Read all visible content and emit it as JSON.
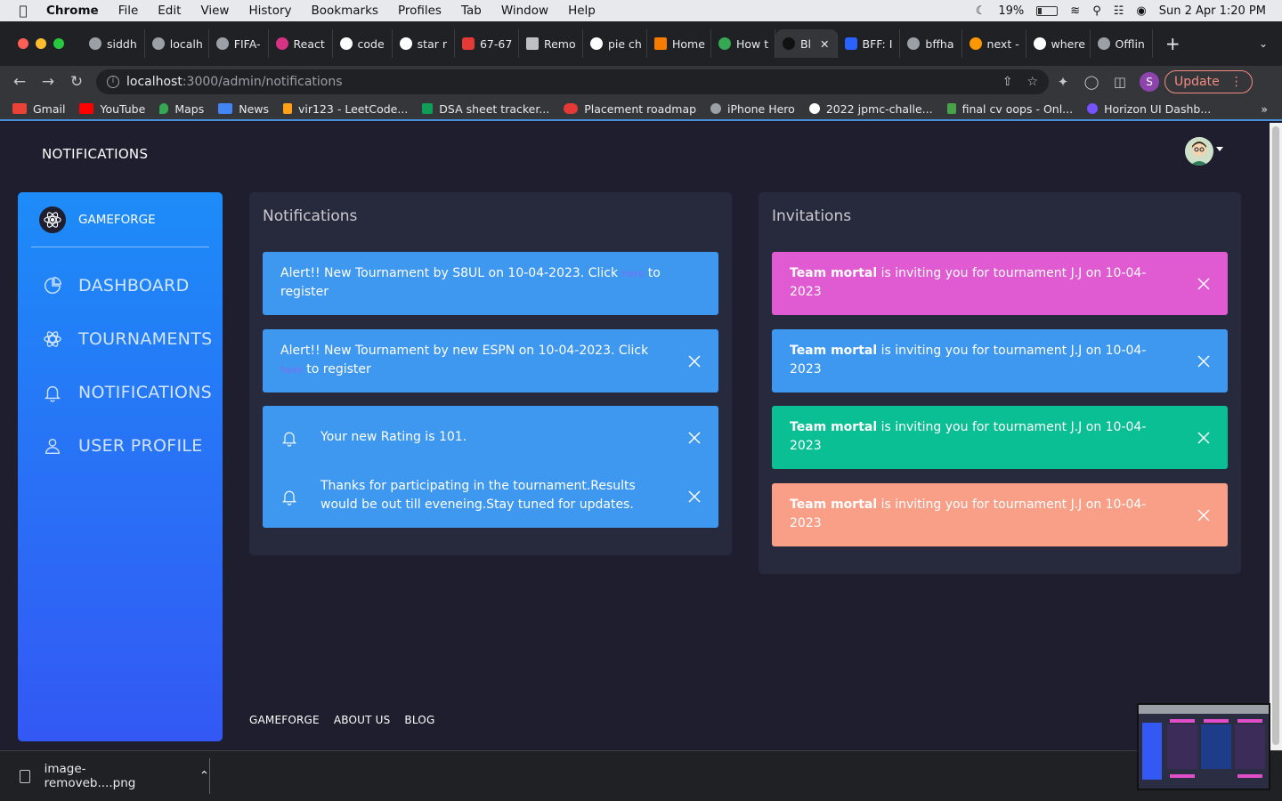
{
  "menubar": {
    "app": "Chrome",
    "items": [
      "File",
      "Edit",
      "View",
      "History",
      "Bookmarks",
      "Profiles",
      "Tab",
      "Window",
      "Help"
    ],
    "battery": "19%",
    "datetime": "Sun 2 Apr  1:20 PM"
  },
  "tabs": [
    {
      "label": "siddh",
      "icon": "github-icon"
    },
    {
      "label": "localh",
      "icon": "globe-icon"
    },
    {
      "label": "FIFA-",
      "icon": "globe-icon"
    },
    {
      "label": "React",
      "icon": "react-icon"
    },
    {
      "label": "code",
      "icon": "google-icon"
    },
    {
      "label": "star r",
      "icon": "google-icon"
    },
    {
      "label": "67-67",
      "icon": "c-icon"
    },
    {
      "label": "Remo",
      "icon": "layers-icon"
    },
    {
      "label": "pie ch",
      "icon": "google-icon"
    },
    {
      "label": "Home",
      "icon": "grid-icon"
    },
    {
      "label": "How t",
      "icon": "link-icon"
    },
    {
      "label": "Bl",
      "icon": "mask-icon",
      "active": true
    },
    {
      "label": "BFF: I",
      "icon": "doc-icon"
    },
    {
      "label": "bffha",
      "icon": "globe-icon"
    },
    {
      "label": "next -",
      "icon": "fire-icon"
    },
    {
      "label": "where",
      "icon": "google-icon"
    },
    {
      "label": "Offlin",
      "icon": "globe-icon"
    }
  ],
  "address": {
    "host": "localhost",
    "path": ":3000/admin/notifications",
    "update_label": "Update",
    "profile_initial": "S"
  },
  "bookmarks": [
    {
      "label": "Gmail",
      "color": "#ea4335"
    },
    {
      "label": "YouTube",
      "color": "#ff0000"
    },
    {
      "label": "Maps",
      "color": "#34a853"
    },
    {
      "label": "News",
      "color": "#4285f4"
    },
    {
      "label": "vir123 - LeetCode...",
      "color": "#ffa116"
    },
    {
      "label": "DSA sheet tracker...",
      "color": "#0f9d58"
    },
    {
      "label": "Placement roadmap",
      "color": "#e53935"
    },
    {
      "label": "iPhone Hero",
      "color": "#9aa0a6"
    },
    {
      "label": "2022 jpmc-challe...",
      "color": "#ffffff"
    },
    {
      "label": "final cv oops - Onl...",
      "color": "#47a248"
    },
    {
      "label": "Horizon UI Dashb...",
      "color": "#7551ff"
    }
  ],
  "bookmarks_more": "»",
  "app": {
    "page_title": "NOTIFICATIONS",
    "brand": "GAMEFORGE",
    "nav": [
      {
        "label": "DASHBOARD",
        "icon": "chart-pie-icon"
      },
      {
        "label": "TOURNAMENTS",
        "icon": "atom-icon"
      },
      {
        "label": "NOTIFICATIONS",
        "icon": "bell-icon"
      },
      {
        "label": "USER PROFILE",
        "icon": "user-icon"
      }
    ],
    "notifications": {
      "title": "Notifications",
      "items": [
        {
          "before": "Alert!! New Tournament by S8UL on 10-04-2023. Click ",
          "link": "here",
          "after": " to register"
        },
        {
          "before": "Alert!! New Tournament by new ESPN on 10-04-2023. Click ",
          "link": "here",
          "after": " to register"
        },
        {
          "text": "Your new Rating is 101."
        },
        {
          "text": "Thanks for participating in the tournament.Results would be out till eveneing.Stay tuned for updates."
        }
      ]
    },
    "invitations": {
      "title": "Invitations",
      "items": [
        {
          "team": "Team mortal",
          "text": " is inviting you for tournament J.J on 10-04-2023",
          "color": "#e05ad1"
        },
        {
          "team": "Team mortal",
          "text": " is inviting you for tournament J.J on 10-04-2023",
          "color": "#3e98f0"
        },
        {
          "team": "Team mortal",
          "text": " is inviting you for tournament J.J on 10-04-2023",
          "color": "#0bbf94"
        },
        {
          "team": "Team mortal",
          "text": " is inviting you for tournament J.J on 10-04-2023",
          "color": "#f99f87"
        }
      ]
    },
    "footer": [
      "GAMEFORGE",
      "ABOUT US",
      "BLOG"
    ]
  },
  "downloads": {
    "file": "image-removeb....png"
  }
}
